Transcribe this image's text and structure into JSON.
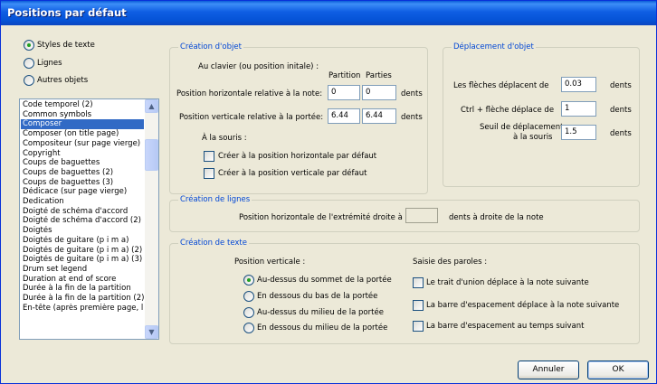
{
  "window": {
    "title": "Positions par défaut"
  },
  "type_selector": {
    "options": [
      "Styles de texte",
      "Lignes",
      "Autres objets"
    ],
    "selected": "Styles de texte"
  },
  "styles_list": {
    "items": [
      "Code temporel (2)",
      "Common symbols",
      "Composer",
      "Composer (on title page)",
      "Compositeur (sur page vierge)",
      "Copyright",
      "Coups de baguettes",
      "Coups de baguettes (2)",
      "Coups de baguettes (3)",
      "Dédicace (sur page vierge)",
      "Dedication",
      "Doigté de schéma d'accord",
      "Doigté de schéma d'accord (2)",
      "Doigtés",
      "Doigtés de guitare (p i m a)",
      "Doigtés de guitare (p i m a) (2)",
      "Doigtés de guitare (p i m a) (3)",
      "Drum set legend",
      "Duration at end of score",
      "Durée à la fin de la partition",
      "Durée à la fin de la partition (2)",
      "En-tête (après première page, l"
    ],
    "selected": "Composer"
  },
  "creation_objet": {
    "title": "Création d'objet",
    "keyboard_label": "Au clavier (ou position initale) :",
    "col_partition": "Partition",
    "col_parties": "Parties",
    "horiz_label": "Position horizontale relative à la note:",
    "horiz_partition": "0",
    "horiz_parties": "0",
    "vert_label": "Position verticale relative à la portée:",
    "vert_partition": "6.44",
    "vert_parties": "6.44",
    "unit": "dents",
    "mouse_label": "À la souris :",
    "check_horiz": "Créer à la position horizontale par défaut",
    "check_vert": "Créer à la position verticale par défaut"
  },
  "deplacement_objet": {
    "title": "Déplacement d'objet",
    "arrows_label": "Les flèches déplacent de",
    "arrows_value": "0.03",
    "ctrl_label": "Ctrl + flèche déplace de",
    "ctrl_value": "1",
    "threshold_label_1": "Seuil de déplacement",
    "threshold_label_2": "à la souris",
    "threshold_value": "1.5",
    "unit": "dents"
  },
  "creation_lignes": {
    "title": "Création de lignes",
    "label": "Position horizontale de l'extrémité droite à",
    "value": "",
    "suffix": "dents à droite de la note"
  },
  "creation_texte": {
    "title": "Création de texte",
    "vertical_label": "Position verticale :",
    "vertical_options": [
      "Au-dessus du sommet de la portée",
      "En dessous du bas de la portée",
      "Au-dessus du milieu de la portée",
      "En dessous du milieu de la portée"
    ],
    "vertical_selected": "Au-dessus du sommet de la portée",
    "lyrics_label": "Saisie des paroles :",
    "lyrics_options": [
      "Le trait d'union déplace à la note suivante",
      "La barre d'espacement déplace à la note suivante",
      "La barre d'espacement au temps suivant"
    ]
  },
  "buttons": {
    "cancel": "Annuler",
    "ok": "OK"
  },
  "colors": {
    "accent": "#316ac5",
    "group_title": "#0046d5",
    "titlebar": "#0a5dd8",
    "radio_dot": "#21a121"
  }
}
